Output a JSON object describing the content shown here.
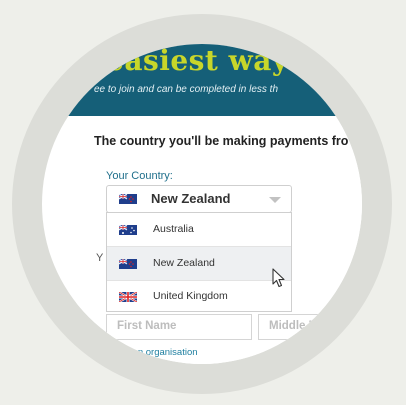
{
  "banner": {
    "title": "easiest way t",
    "subtitle": "ee to join and can be completed in less th"
  },
  "form": {
    "heading": "The country you'll be making payments fro",
    "country_label": "Your Country:",
    "selected_country": "New Zealand",
    "countries": [
      {
        "label": "Australia",
        "flag_icon": "australia-flag-icon",
        "highlighted": false
      },
      {
        "label": "New Zealand",
        "flag_icon": "new-zealand-flag-icon",
        "highlighted": true
      },
      {
        "label": "United Kingdom",
        "flag_icon": "uk-flag-icon",
        "highlighted": false
      }
    ],
    "hidden_fragment": "Y",
    "first_name_placeholder": "First Name",
    "middle_name_placeholder": "Middle Nam",
    "register_org_link": "gister as an organisation"
  },
  "colors": {
    "banner_bg": "#155f78",
    "banner_title": "#c8d62a",
    "label_blue": "#1f6f8b",
    "link_blue": "#1f7fa0",
    "background": "#eeefea",
    "ring": "#dcddd8"
  }
}
